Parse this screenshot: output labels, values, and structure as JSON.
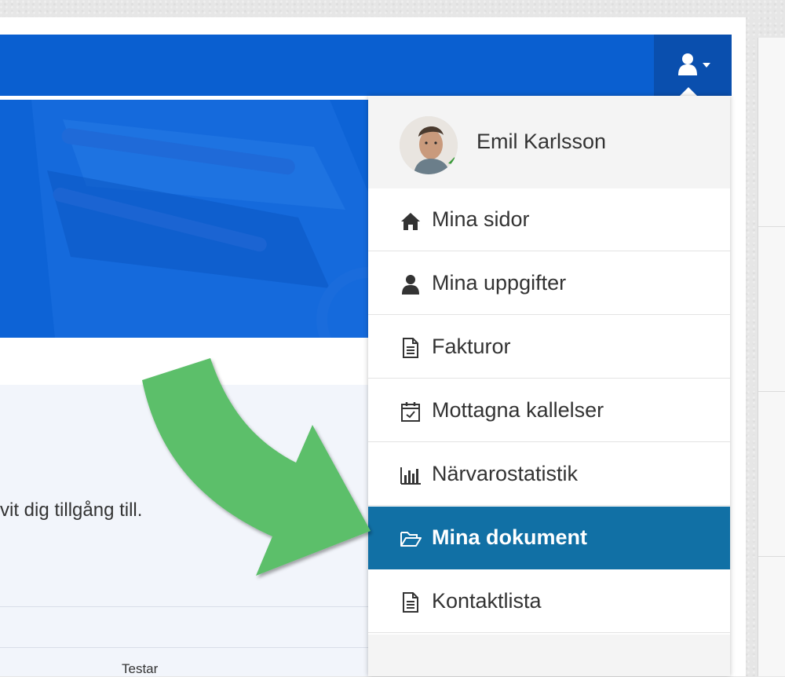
{
  "user": {
    "name": "Emil Karlsson"
  },
  "menu": {
    "items": [
      {
        "label": "Mina sidor",
        "icon": "home-icon"
      },
      {
        "label": "Mina uppgifter",
        "icon": "user-icon"
      },
      {
        "label": "Fakturor",
        "icon": "document-icon"
      },
      {
        "label": "Mottagna kallelser",
        "icon": "calendar-check-icon"
      },
      {
        "label": "Närvarostatistik",
        "icon": "bar-chart-icon"
      },
      {
        "label": "Mina dokument",
        "icon": "folder-open-icon",
        "active": true
      },
      {
        "label": "Kontaktlista",
        "icon": "document-icon"
      }
    ]
  },
  "content": {
    "partial_text": "vit dig tillgång till.",
    "table_header_partial": "Testar"
  },
  "colors": {
    "topbar": "#0a5fd0",
    "user_toggle": "#0a4fae",
    "active_item": "#1170a5",
    "arrow": "#5cbf6a"
  }
}
